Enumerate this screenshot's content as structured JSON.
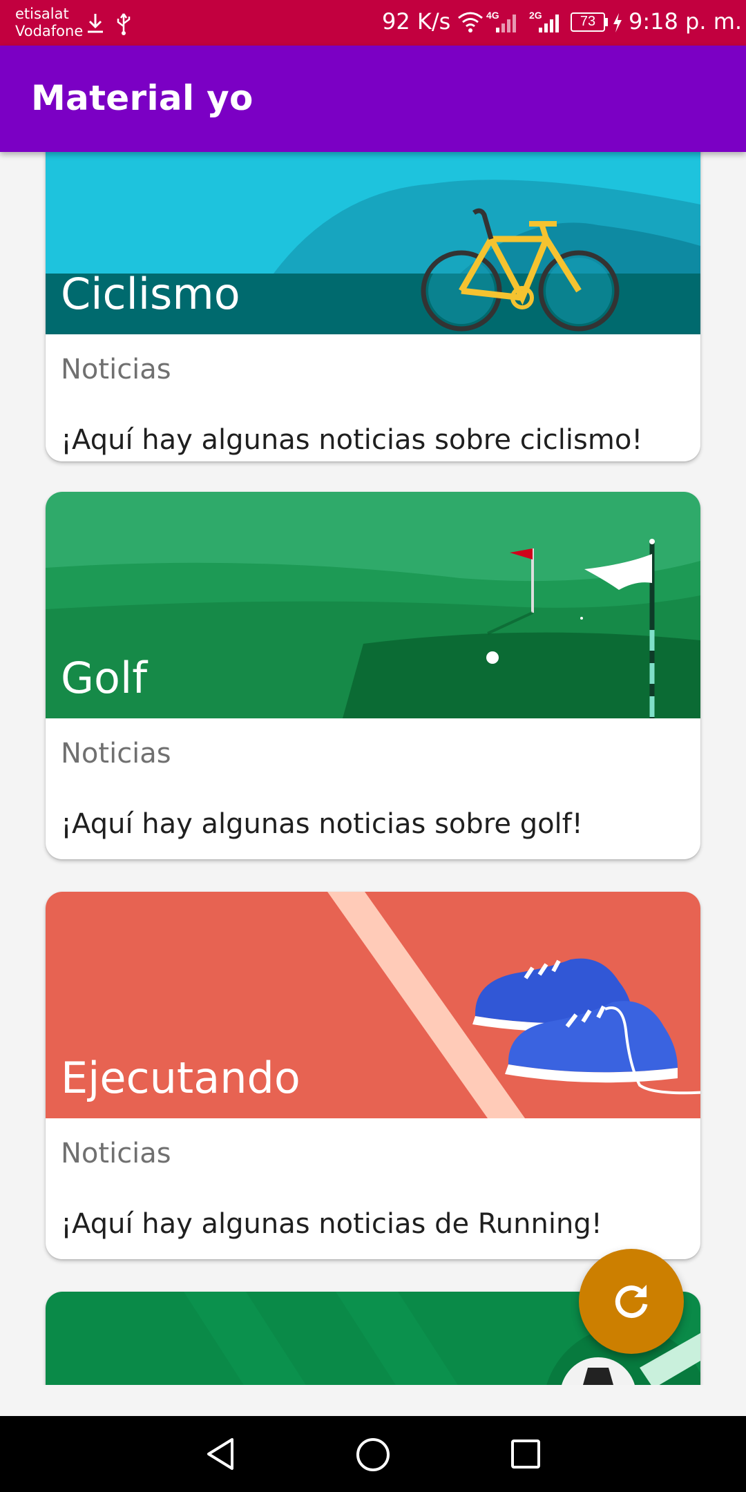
{
  "status_bar": {
    "carrier_line1": "etisalat",
    "carrier_line2": "Vodafone",
    "speed": "92 K/s",
    "net1": "4G",
    "net2": "2G",
    "battery": "73",
    "time": "9:18 p. m.",
    "background": "#c2003f"
  },
  "app_bar": {
    "title": "Material yo",
    "background": "#7b00c4"
  },
  "cards": [
    {
      "title": "Ciclismo",
      "subtitle": "Noticias",
      "text": "¡Aquí hay algunas noticias sobre ciclismo!",
      "image": "cycling-bike-illustration"
    },
    {
      "title": "Golf",
      "subtitle": "Noticias",
      "text": "¡Aquí hay algunas noticias sobre golf!",
      "image": "golf-course-illustration"
    },
    {
      "title": "Ejecutando",
      "subtitle": "Noticias",
      "text": "¡Aquí hay algunas noticias de Running!",
      "image": "running-shoes-illustration"
    },
    {
      "image": "soccer-field-illustration"
    }
  ],
  "fab": {
    "icon": "refresh-icon",
    "background": "#cc7f00"
  },
  "nav_bar": {
    "back_icon": "back-triangle-icon",
    "home_icon": "home-circle-icon",
    "recents_icon": "recents-square-icon"
  }
}
